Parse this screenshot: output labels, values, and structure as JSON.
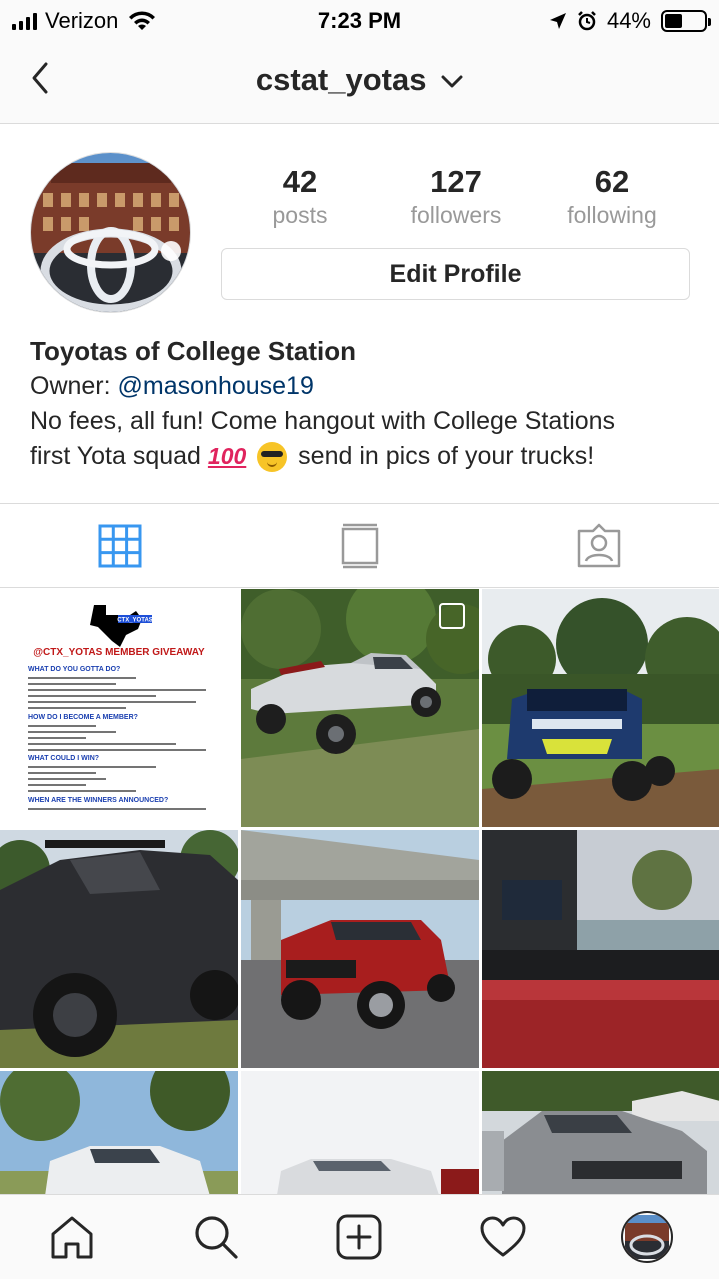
{
  "status_bar": {
    "carrier": "Verizon",
    "time": "7:23 PM",
    "battery": "44%",
    "battery_level": 0.44
  },
  "header": {
    "username": "cstat_yotas"
  },
  "profile": {
    "posts_count": "42",
    "posts_label": "posts",
    "followers_count": "127",
    "followers_label": "followers",
    "following_count": "62",
    "following_label": "following",
    "edit_button": "Edit Profile",
    "display_name": "Toyotas of College Station",
    "owner_prefix": "Owner: ",
    "owner_handle": "@masonhouse19",
    "bio_line1": "No fees, all fun! Come hangout with College Stations",
    "bio_line2_start": "first Yota squad ",
    "bio_emoji_100": "100",
    "bio_line2_end": " send in pics of your trucks!"
  },
  "tabs": [
    {
      "name": "grid",
      "active": true
    },
    {
      "name": "feed",
      "active": false
    },
    {
      "name": "tagged",
      "active": false
    }
  ],
  "grid": {
    "giveaway_post": {
      "badge": "CTX_YOTAS",
      "title": "@CTX_YOTAS MEMBER GIVEAWAY",
      "q1": "WHAT DO YOU GOTTA DO?",
      "q2": "HOW DO I BECOME A MEMBER?",
      "q3": "WHAT COULD I WIN?",
      "q4": "WHEN ARE THE WINNERS ANNOUNCED?"
    }
  },
  "colors": {
    "accent_blue": "#3897f0",
    "mention": "#003569",
    "muted": "#999999",
    "border": "#dbdbdb"
  }
}
